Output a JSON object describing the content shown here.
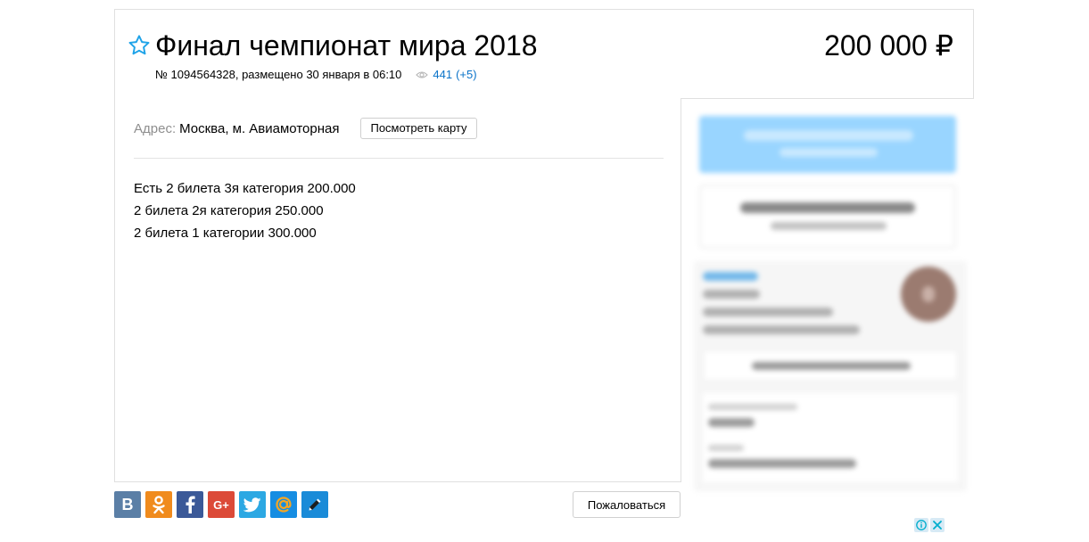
{
  "listing": {
    "title": "Финал чемпионат мира 2018",
    "price": "200 000 ₽",
    "meta": "№ 1094564328, размещено 30 января в 06:10",
    "views_count": "441",
    "views_delta": "(+5)"
  },
  "address": {
    "label": "Адрес:",
    "value": "Москва, м. Авиамоторная",
    "map_button": "Посмотреть карту"
  },
  "description": [
    "Есть 2 билета 3я категория 200.000",
    "2 билета 2я категория 250.000",
    "2 билета 1 категории 300.000"
  ],
  "share": {
    "vk_label": "В",
    "gplus_label": "G+"
  },
  "report_button": "Пожаловаться",
  "icons": {
    "favorite": "star-outline-icon",
    "views": "eye-icon",
    "share": [
      "vk-icon",
      "odnoklassniki-icon",
      "facebook-icon",
      "google-plus-icon",
      "twitter-icon",
      "mail-ru-icon",
      "livejournal-icon"
    ],
    "ad": [
      "adchoices-info-icon",
      "close-icon"
    ]
  },
  "colors": {
    "accent_blue": "#0a73c9",
    "star_blue": "#1fa3e8",
    "contact_button_blurred": "#99d5ff"
  }
}
